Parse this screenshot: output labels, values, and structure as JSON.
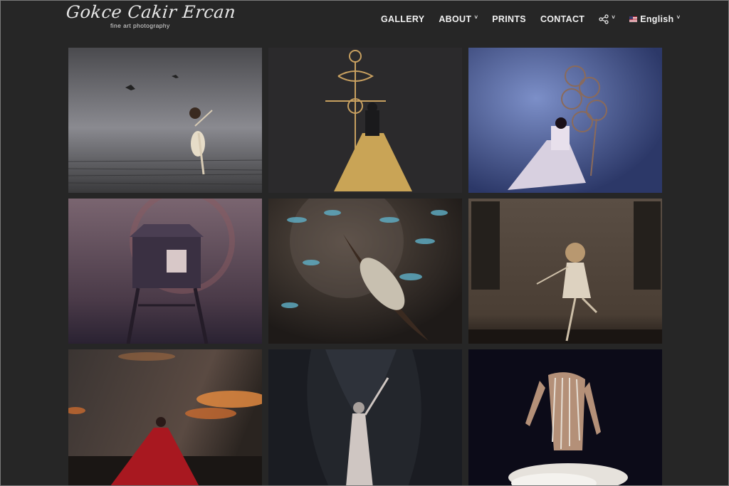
{
  "header": {
    "logo_script": "Gokce Cakir Ercan",
    "logo_tagline": "fine art photography"
  },
  "nav": {
    "items": [
      {
        "label": "GALLERY",
        "dropdown": false
      },
      {
        "label": "ABOUT",
        "dropdown": true
      },
      {
        "label": "PRINTS",
        "dropdown": false
      },
      {
        "label": "CONTACT",
        "dropdown": false
      }
    ],
    "share_icon": "share-icon",
    "language": "English",
    "caret": "˅"
  },
  "gallery": {
    "tiles": [
      {
        "name": "woman-dancing-on-water-with-birds",
        "bg": "#5a5a5e"
      },
      {
        "name": "woman-in-gold-dress-with-symbol",
        "bg": "#2b2a2c"
      },
      {
        "name": "woman-seated-with-dreamcatcher",
        "bg": "#3c4a7a"
      },
      {
        "name": "girl-in-wooden-stilt-house",
        "bg": "#5c4a55"
      },
      {
        "name": "woman-in-boat-with-fish",
        "bg": "#2a2420"
      },
      {
        "name": "woman-dancing-in-empty-room",
        "bg": "#4a3e35"
      },
      {
        "name": "woman-in-red-dress-under-sunset",
        "bg": "#2f2a28"
      },
      {
        "name": "woman-in-dark-forest",
        "bg": "#23262c"
      },
      {
        "name": "woman-falling-with-feathers",
        "bg": "#0c0b18"
      }
    ]
  }
}
